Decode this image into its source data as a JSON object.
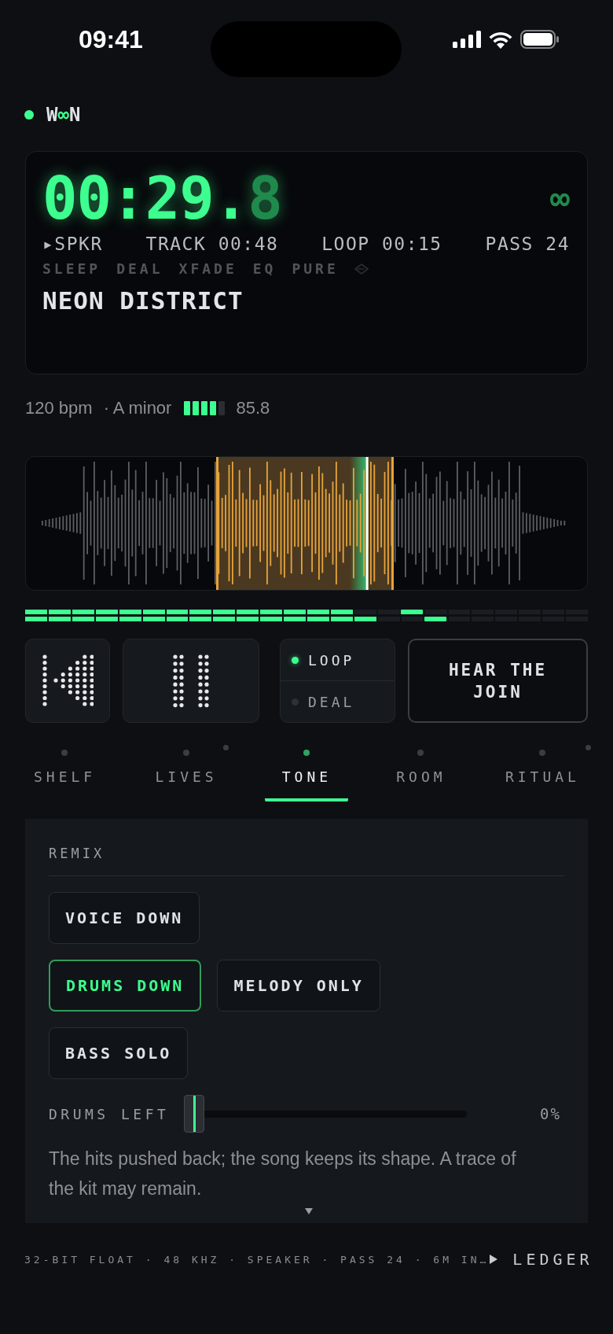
{
  "status_bar": {
    "time": "09:41"
  },
  "brand": {
    "name": "W∞N",
    "live": true
  },
  "display": {
    "timer": "00:29.8",
    "loop_mark": "∞",
    "info": [
      "▸SPKR",
      "TRACK 00:48",
      "LOOP 00:15",
      "PASS 24"
    ],
    "modes": [
      "SLEEP",
      "DEAL",
      "XFADE",
      "EQ",
      "PURE"
    ],
    "title": "NEON DISTRICT"
  },
  "meta": {
    "tempo": "120 bpm",
    "key": "· A minor",
    "level": 0.8,
    "reading": "85.8"
  },
  "waveform": {
    "level": 0.62
  },
  "meters": [
    {
      "level": 0.583,
      "peak": {
        "level": 0.708
      }
    },
    {
      "level": 0.625,
      "peak": {
        "level": 0.75
      }
    }
  ],
  "transport": {
    "modes": [
      {
        "label": "LOOP",
        "selected": true
      },
      {
        "label": "DEAL",
        "selected": false
      }
    ],
    "action": "HEAR THE JOIN"
  },
  "tabs": [
    {
      "label": "SHELF",
      "selected": false,
      "alert": false
    },
    {
      "label": "LIVES",
      "selected": false,
      "alert": true
    },
    {
      "label": "TONE",
      "selected": true,
      "alert": false
    },
    {
      "label": "ROOM",
      "selected": false,
      "alert": false
    },
    {
      "label": "RITUAL",
      "selected": false,
      "alert": true
    }
  ],
  "remix": {
    "title": "REMIX",
    "options": [
      [
        {
          "label": "VOICE DOWN",
          "selected": false
        }
      ],
      [
        {
          "label": "DRUMS DOWN",
          "selected": true
        },
        {
          "label": "MELODY ONLY",
          "selected": false
        }
      ],
      [
        {
          "label": "BASS SOLO",
          "selected": false
        }
      ]
    ],
    "slider": {
      "label": "DRUMS LEFT",
      "level": 0,
      "reading": "0%"
    },
    "description": "The hits pushed back; the song keeps its shape. A trace of the kit may remain."
  },
  "footer": {
    "info": "32-BIT FLOAT · 48 KHZ · SPEAKER · PASS 24 · 6M IN…",
    "link": "LEDGER"
  }
}
